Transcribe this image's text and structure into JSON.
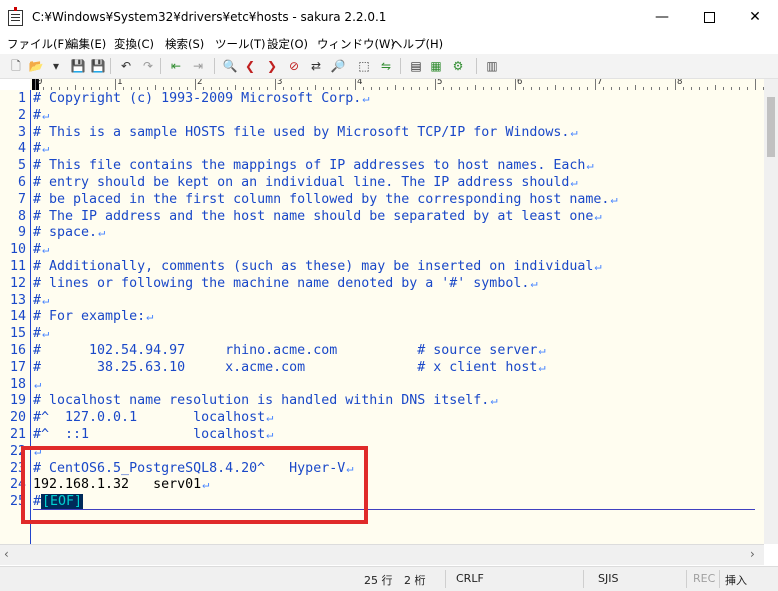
{
  "window": {
    "title": "C:¥Windows¥System32¥drivers¥etc¥hosts - sakura 2.2.0.1",
    "minimize_icon": "minimize-icon",
    "maximize_icon": "maximize-icon",
    "close_icon": "close-icon",
    "minimize_glyph": "—",
    "close_glyph": "✕"
  },
  "menu": {
    "items": [
      {
        "label": "ファイル(F)"
      },
      {
        "label": "編集(E)"
      },
      {
        "label": "変換(C)"
      },
      {
        "label": "検索(S)"
      },
      {
        "label": "ツール(T)"
      },
      {
        "label": "設定(O)"
      },
      {
        "label": "ウィンドウ(W)"
      },
      {
        "label": "ヘルプ(H)"
      }
    ]
  },
  "toolbar": {
    "icons": [
      {
        "name": "new-file-icon",
        "glyph": "🗋",
        "color": "#555555"
      },
      {
        "name": "open-folder-icon",
        "glyph": "📂",
        "color": "#c89a2a"
      },
      {
        "name": "dropdown-arrow-icon",
        "glyph": "▾",
        "color": "#333333"
      },
      {
        "name": "save-icon",
        "glyph": "💾",
        "color": "#3b4fa0"
      },
      {
        "name": "save-as-icon",
        "glyph": "💾",
        "color": "#7a3aa0"
      },
      {
        "name": "undo-icon",
        "glyph": "↶",
        "color": "#333333"
      },
      {
        "name": "redo-icon",
        "glyph": "↷",
        "color": "#999999"
      },
      {
        "name": "jump-back-icon",
        "glyph": "⇤",
        "color": "#2e8b2e"
      },
      {
        "name": "jump-forward-icon",
        "glyph": "⇥",
        "color": "#9a9a9a"
      },
      {
        "name": "search-icon",
        "glyph": "🔍",
        "color": "#333333"
      },
      {
        "name": "search-prev-icon",
        "glyph": "❮",
        "color": "#c02020"
      },
      {
        "name": "search-next-icon",
        "glyph": "❯",
        "color": "#c02020"
      },
      {
        "name": "search-clear-icon",
        "glyph": "⊘",
        "color": "#c02020"
      },
      {
        "name": "replace-icon",
        "glyph": "⇄",
        "color": "#333333"
      },
      {
        "name": "grep-icon",
        "glyph": "🔎",
        "color": "#b08a10"
      },
      {
        "name": "tag-jump-icon",
        "glyph": "⬚",
        "color": "#333333"
      },
      {
        "name": "compare-icon",
        "glyph": "⇋",
        "color": "#2e8b2e"
      },
      {
        "name": "outline-icon",
        "glyph": "▤",
        "color": "#333333"
      },
      {
        "name": "function-list-icon",
        "glyph": "▦",
        "color": "#2e8b2e"
      },
      {
        "name": "settings-icon",
        "glyph": "⚙",
        "color": "#2e8b2e"
      },
      {
        "name": "window-list-icon",
        "glyph": "▥",
        "color": "#555555"
      }
    ]
  },
  "ruler": {
    "labels": [
      "0",
      "1",
      "2",
      "3",
      "4",
      "5",
      "6",
      "7",
      "8"
    ]
  },
  "editor": {
    "eol_mark": "↵",
    "eof_marker": "[EOF]",
    "lines": [
      {
        "num": "1",
        "text": "# Copyright (c) 1993-2009 Microsoft Corp.",
        "eol": true,
        "type": "comment"
      },
      {
        "num": "2",
        "text": "#",
        "eol": true,
        "type": "comment"
      },
      {
        "num": "3",
        "text": "# This is a sample HOSTS file used by Microsoft TCP/IP for Windows.",
        "eol": true,
        "type": "comment"
      },
      {
        "num": "4",
        "text": "#",
        "eol": true,
        "type": "comment"
      },
      {
        "num": "5",
        "text": "# This file contains the mappings of IP addresses to host names. Each",
        "eol": true,
        "type": "comment"
      },
      {
        "num": "6",
        "text": "# entry should be kept on an individual line. The IP address should",
        "eol": true,
        "type": "comment"
      },
      {
        "num": "7",
        "text": "# be placed in the first column followed by the corresponding host name.",
        "eol": true,
        "type": "comment"
      },
      {
        "num": "8",
        "text": "# The IP address and the host name should be separated by at least one",
        "eol": true,
        "type": "comment"
      },
      {
        "num": "9",
        "text": "# space.",
        "eol": true,
        "type": "comment"
      },
      {
        "num": "10",
        "text": "#",
        "eol": true,
        "type": "comment"
      },
      {
        "num": "11",
        "text": "# Additionally, comments (such as these) may be inserted on individual",
        "eol": true,
        "type": "comment"
      },
      {
        "num": "12",
        "text": "# lines or following the machine name denoted by a '#' symbol.",
        "eol": true,
        "type": "comment"
      },
      {
        "num": "13",
        "text": "#",
        "eol": true,
        "type": "comment"
      },
      {
        "num": "14",
        "text": "# For example:",
        "eol": true,
        "type": "comment"
      },
      {
        "num": "15",
        "text": "#",
        "eol": true,
        "type": "comment"
      },
      {
        "num": "16",
        "text": "#      102.54.94.97     rhino.acme.com          # source server",
        "eol": true,
        "type": "comment"
      },
      {
        "num": "17",
        "text": "#       38.25.63.10     x.acme.com              # x client host",
        "eol": true,
        "type": "comment"
      },
      {
        "num": "18",
        "text": "",
        "eol": true,
        "type": "comment"
      },
      {
        "num": "19",
        "text": "# localhost name resolution is handled within DNS itself.",
        "eol": true,
        "type": "comment"
      },
      {
        "num": "20",
        "text": "#^  127.0.0.1       localhost",
        "eol": true,
        "type": "comment"
      },
      {
        "num": "21",
        "text": "#^  ::1             localhost",
        "eol": true,
        "type": "comment"
      },
      {
        "num": "22",
        "text": "",
        "eol": true,
        "type": "comment"
      },
      {
        "num": "23",
        "text": "# CentOS6.5_PostgreSQL8.4.20^   Hyper-V",
        "eol": true,
        "type": "comment"
      },
      {
        "num": "24",
        "text": "192.168.1.32   serv01",
        "eol": true,
        "type": "plain"
      },
      {
        "num": "25",
        "text": "#",
        "eol": false,
        "type": "comment",
        "eof": true
      }
    ]
  },
  "statusbar": {
    "line": "25 行",
    "column": "2 桁",
    "eol_type": "CRLF",
    "encoding": "SJIS",
    "rec": "REC",
    "mode": "挿入"
  },
  "scrollbar": {
    "left_arrow": "‹",
    "right_arrow": "›"
  },
  "colors": {
    "comment": "#1a48c8",
    "eol_mark": "#4a86ff",
    "editor_bg": "#fffdf0",
    "annotation": "#e02a2a",
    "eof_bg": "#002a5a",
    "eof_fg": "#00d1d1"
  }
}
